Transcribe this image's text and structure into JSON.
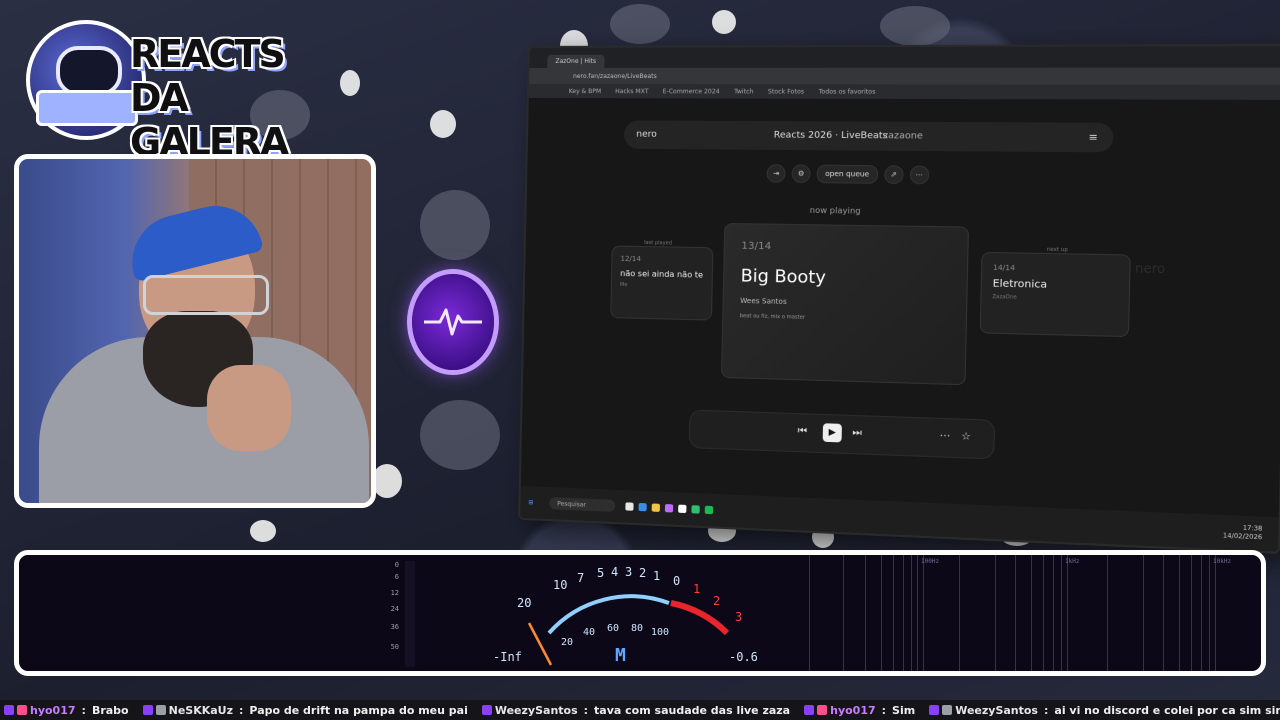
{
  "logo": {
    "line1": "REACTS",
    "line2": "DA GALERA"
  },
  "browser": {
    "tab_title": "ZazOne | Hits",
    "url": "nero.fan/zazaone/LiveBeats",
    "bookmarks": [
      "Key & BPM",
      "Hacks MXT",
      "E-Commerce 2024",
      "Twitch",
      "Stock Fotos",
      "Todos os favoritos"
    ]
  },
  "app": {
    "brand": "nero",
    "title": "Reacts 2026 · LiveBeats",
    "user": "zazaone",
    "menu_icon": "≡",
    "open_queue": "open queue",
    "now_playing_label": "now playing",
    "watermark": "nero",
    "prev": {
      "label": "last played",
      "num": "12/14",
      "title": "não sei ainda não termi...",
      "meta": "Me"
    },
    "current": {
      "num": "13/14",
      "title": "Big Booty",
      "artist": "Wees Santos",
      "desc": "beat ou fiz, mix o master"
    },
    "next": {
      "label": "next up",
      "num": "14/14",
      "title": "Eletronica",
      "meta": "ZazaOne"
    }
  },
  "taskbar": {
    "search_placeholder": "Pesquisar",
    "time": "17:38",
    "date": "14/02/2026"
  },
  "meter": {
    "db_scale": [
      "0",
      "6",
      "12",
      "24",
      "36",
      "50"
    ],
    "vu_scale": [
      "20",
      "10",
      "7",
      "5",
      "4",
      "3",
      "2",
      "1",
      "0",
      "1",
      "2",
      "3"
    ],
    "vu_percent": [
      "20",
      "40",
      "60",
      "80",
      "100"
    ],
    "left_value": "-Inf",
    "mode": "M",
    "right_value": "-0.6",
    "spectrum_labels": [
      "100Hz",
      "1kHz",
      "10kHz"
    ]
  },
  "chat": [
    {
      "user": "hyo017",
      "user_color": "#c77dff",
      "text": "Brabo"
    },
    {
      "user": "NeSKKaUz",
      "user_color": "#e8e8e8",
      "text": "Papo de drift na pampa do meu pai"
    },
    {
      "user": "WeezySantos",
      "user_color": "#e8e8e8",
      "text": "tava com saudade das live zaza"
    },
    {
      "user": "hyo017",
      "user_color": "#c77dff",
      "text": "Sim"
    },
    {
      "user": "WeezySantos",
      "user_color": "#e8e8e8",
      "text": "ai vi no discord e colei por ca  sim sim"
    }
  ]
}
